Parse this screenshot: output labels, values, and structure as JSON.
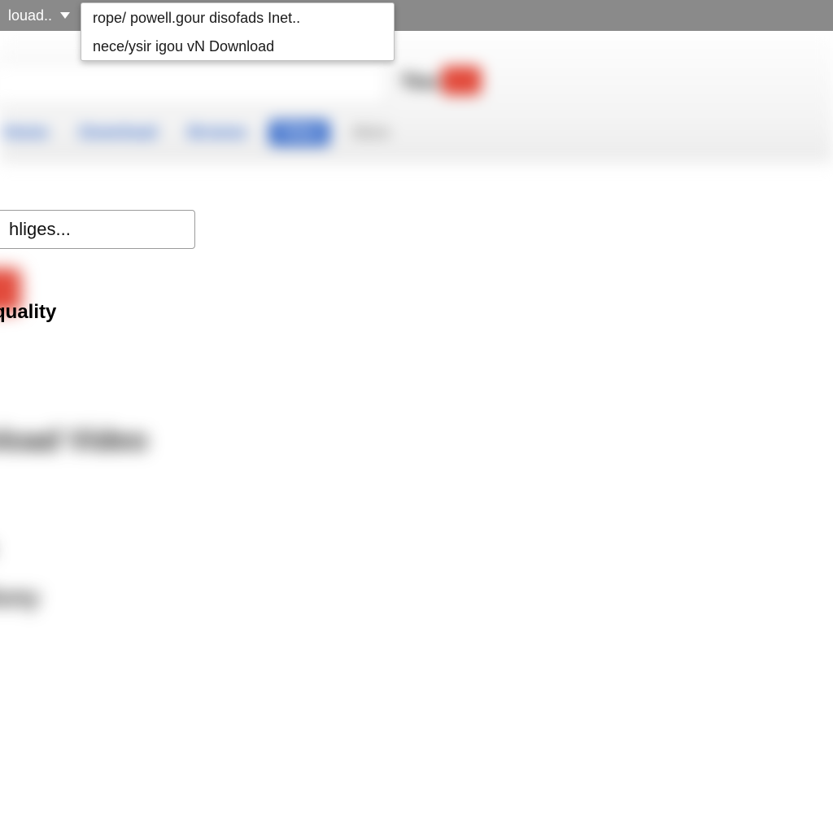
{
  "tab": {
    "label": "louad..",
    "chevron": true
  },
  "address_dropdown": {
    "items": [
      "rope/ powell.gour disofads Inet..",
      "nece/ysir igou vN Download"
    ]
  },
  "header": {
    "logo_text": "You",
    "nav_tabs": [
      "Home",
      "Download",
      "Browse",
      "Video",
      "More"
    ],
    "active_tab_index": 3
  },
  "search_field": {
    "placeholder": "hliges..."
  },
  "labels": {
    "quality": "quality",
    "download_video": "nload Video",
    "line_b": "n",
    "line_buy": "iluny"
  },
  "colors": {
    "accent_red": "#e24a3b",
    "link_blue": "#2b63c8",
    "grey_bar": "#8a8a8a"
  }
}
